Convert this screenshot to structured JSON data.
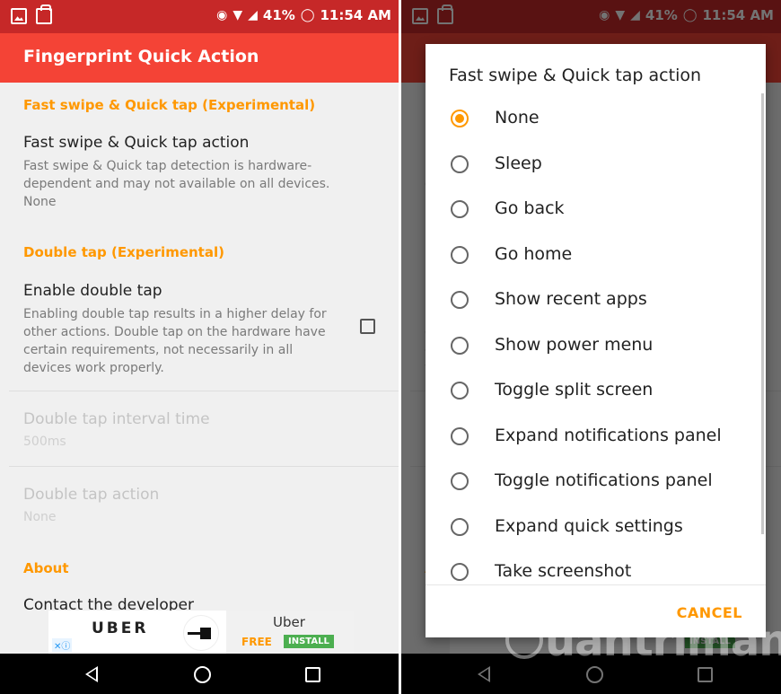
{
  "status_bar": {
    "battery": "41%",
    "time": "11:54 AM"
  },
  "app": {
    "title": "Fingerprint Quick Action"
  },
  "preferences": {
    "category_fast_swipe": "Fast swipe & Quick tap (Experimental)",
    "fast_swipe_title": "Fast swipe & Quick tap action",
    "fast_swipe_summary": "Fast swipe & Quick tap detection is hardware-dependent and may not available on all devices.",
    "fast_swipe_value": "None",
    "category_double_tap": "Double tap (Experimental)",
    "enable_double_tap_title": "Enable double tap",
    "enable_double_tap_summary": "Enabling double tap results in a higher delay for other actions. Double tap on the hardware have certain requirements, not necessarily in all devices work properly.",
    "enable_double_tap_checked": false,
    "interval_title": "Double tap interval time",
    "interval_value": "500ms",
    "double_tap_action_title": "Double tap action",
    "double_tap_action_value": "None",
    "category_about": "About",
    "contact_title": "Contact the developer"
  },
  "ad": {
    "brand": "UBER",
    "name": "Uber",
    "free": "FREE",
    "install": "INSTALL",
    "adchoices": "✕ⓘ"
  },
  "dialog": {
    "title": "Fast swipe & Quick tap action",
    "selected": "None",
    "options": [
      "None",
      "Sleep",
      "Go back",
      "Go home",
      "Show recent apps",
      "Show power menu",
      "Toggle split screen",
      "Expand notifications panel",
      "Toggle notifications panel",
      "Expand quick settings",
      "Take screenshot"
    ],
    "cancel": "CANCEL"
  },
  "watermark": "uantrimang",
  "colors": {
    "statusbar": "#c62828",
    "appbar": "#f44336",
    "accent": "#ff9800"
  },
  "icons": [
    "image-icon",
    "shopping-bag-icon",
    "location-icon",
    "wifi-icon",
    "signal-icon",
    "battery-icon",
    "back-icon",
    "home-icon",
    "recents-icon"
  ]
}
